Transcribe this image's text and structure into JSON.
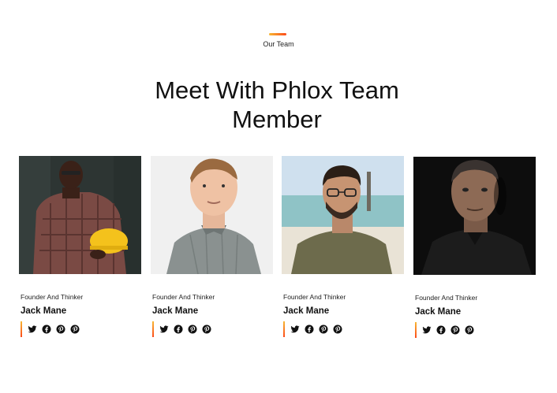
{
  "section": {
    "eyebrow": "Our Team",
    "title_line1": "Meet With Phlox Team",
    "title_line2": "Member",
    "accent_colors": [
      "#f7b733",
      "#fc4a1a"
    ]
  },
  "members": [
    {
      "role": "Founder And Thinker",
      "name": "Jack Mane",
      "photo": "man-with-hard-hat"
    },
    {
      "role": "Founder And Thinker",
      "name": "Jack Mane",
      "photo": "young-man-grey-shirt"
    },
    {
      "role": "Founder And Thinker",
      "name": "Jack Mane",
      "photo": "man-on-beach"
    },
    {
      "role": "Founder And Thinker",
      "name": "Jack Mane",
      "photo": "older-man-dark-background"
    }
  ],
  "social_icons": [
    "twitter-icon",
    "facebook-icon",
    "pinterest-icon",
    "pinterest-icon"
  ]
}
